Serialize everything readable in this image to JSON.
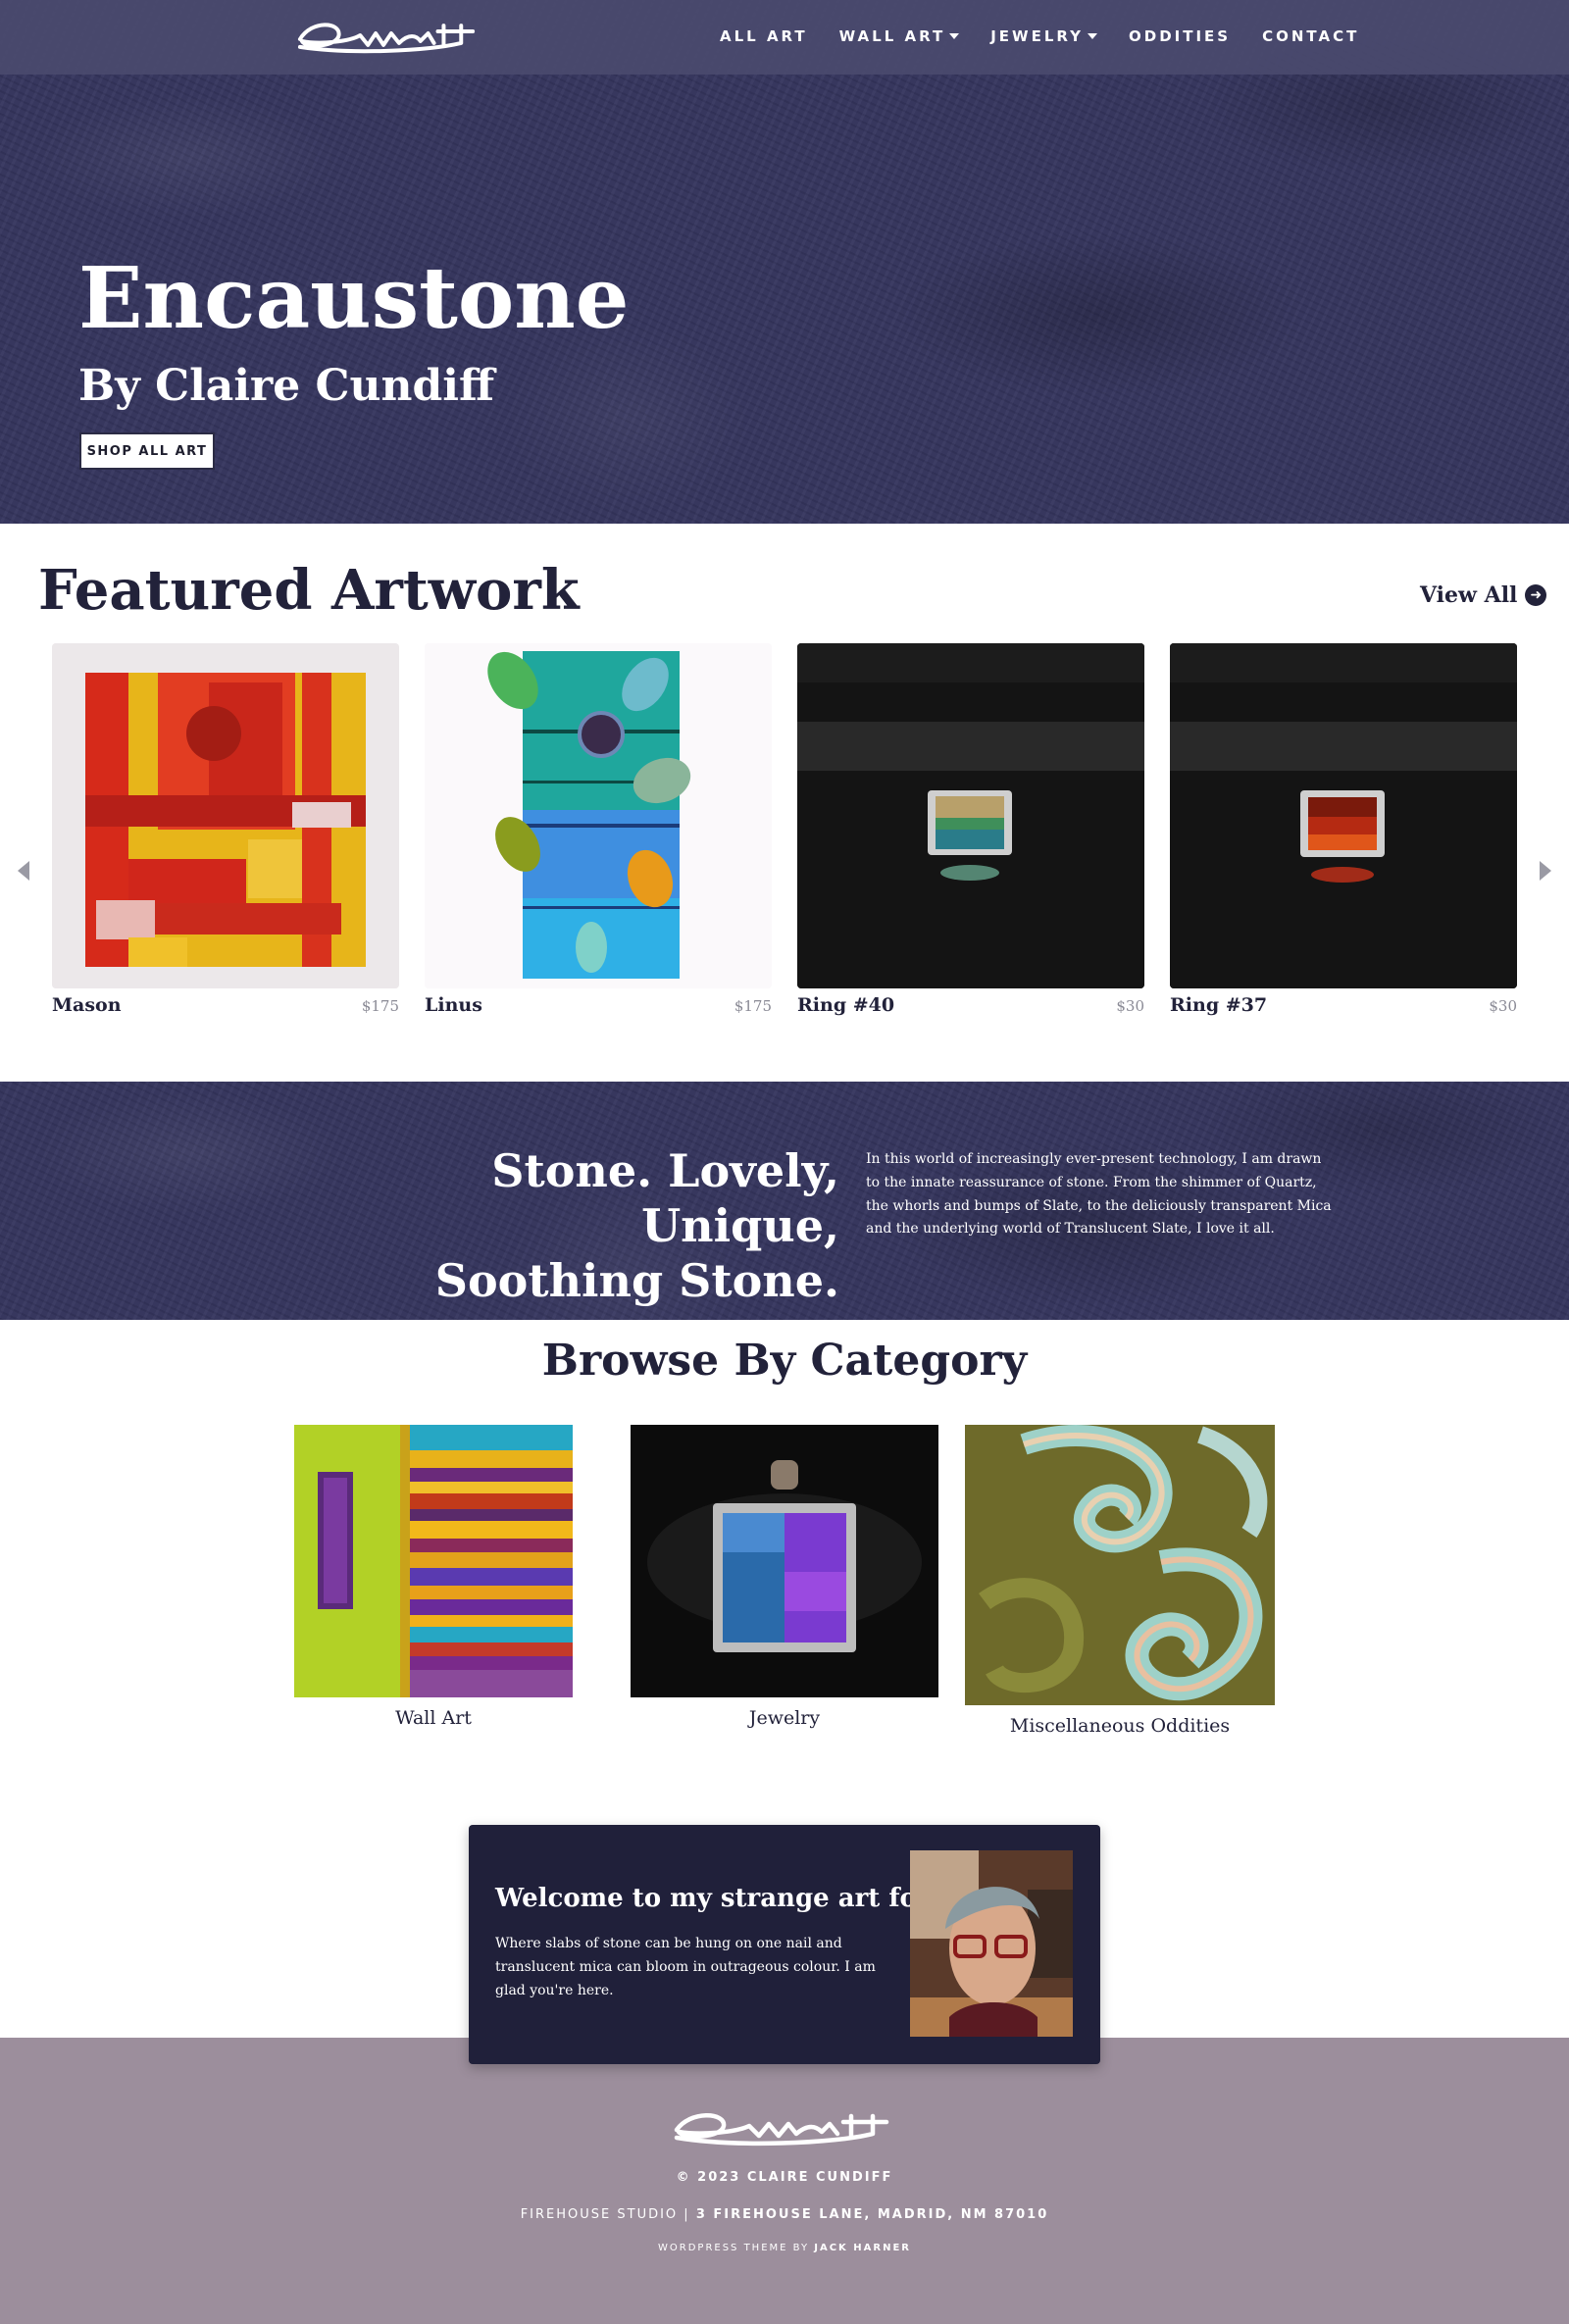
{
  "nav": {
    "logo_text": "Cundiff",
    "links": [
      {
        "label": "ALL ART",
        "has_caret": false
      },
      {
        "label": "WALL ART",
        "has_caret": true
      },
      {
        "label": "JEWELRY",
        "has_caret": true
      },
      {
        "label": "ODDITIES",
        "has_caret": false
      },
      {
        "label": "CONTACT",
        "has_caret": false
      }
    ]
  },
  "hero": {
    "title": "Encaustone",
    "subtitle": "By Claire Cundiff",
    "button_label": "SHOP ALL ART"
  },
  "featured": {
    "title": "Featured Artwork",
    "view_all_label": "View All",
    "items": [
      {
        "name": "Mason",
        "price": "$175"
      },
      {
        "name": "Linus",
        "price": "$175"
      },
      {
        "name": "Ring #40",
        "price": "$30"
      },
      {
        "name": "Ring #37",
        "price": "$30"
      }
    ]
  },
  "band": {
    "title_line1": "Stone. Lovely, Unique,",
    "title_line2": "Soothing Stone.",
    "text": "In this world of increasingly ever-present technology, I am drawn to the innate reassurance of stone. From the shimmer of Quartz, the whorls and bumps of Slate, to the deliciously transparent Mica and the underlying world of Translucent Slate, I love it all."
  },
  "categories": {
    "title": "Browse By Category",
    "items": [
      {
        "label": "Wall Art"
      },
      {
        "label": "Jewelry"
      },
      {
        "label": "Miscellaneous Oddities"
      }
    ]
  },
  "welcome": {
    "title": "Welcome to my strange art form.",
    "text": "Where slabs of stone can be hung on one nail and translucent mica can bloom in outrageous colour. I am glad you're here."
  },
  "footer": {
    "logo_text": "Cundiff",
    "copyright": "© 2023 CLAIRE CUNDIFF",
    "studio": "FIREHOUSE STUDIO | ",
    "address": "3 FIREHOUSE LANE, MADRID, NM 87010",
    "theme_prefix": "WORDPRESS THEME BY ",
    "theme_author": "JACK HARNER"
  },
  "colors": {
    "navy_stone": "#36365f",
    "dark_card": "#20203a",
    "footer_mauve": "#9c8e9c",
    "heading": "#22223a"
  },
  "icons": [
    "caret-down-icon",
    "arrow-circle-right-icon",
    "chevron-left-icon",
    "chevron-right-icon"
  ]
}
